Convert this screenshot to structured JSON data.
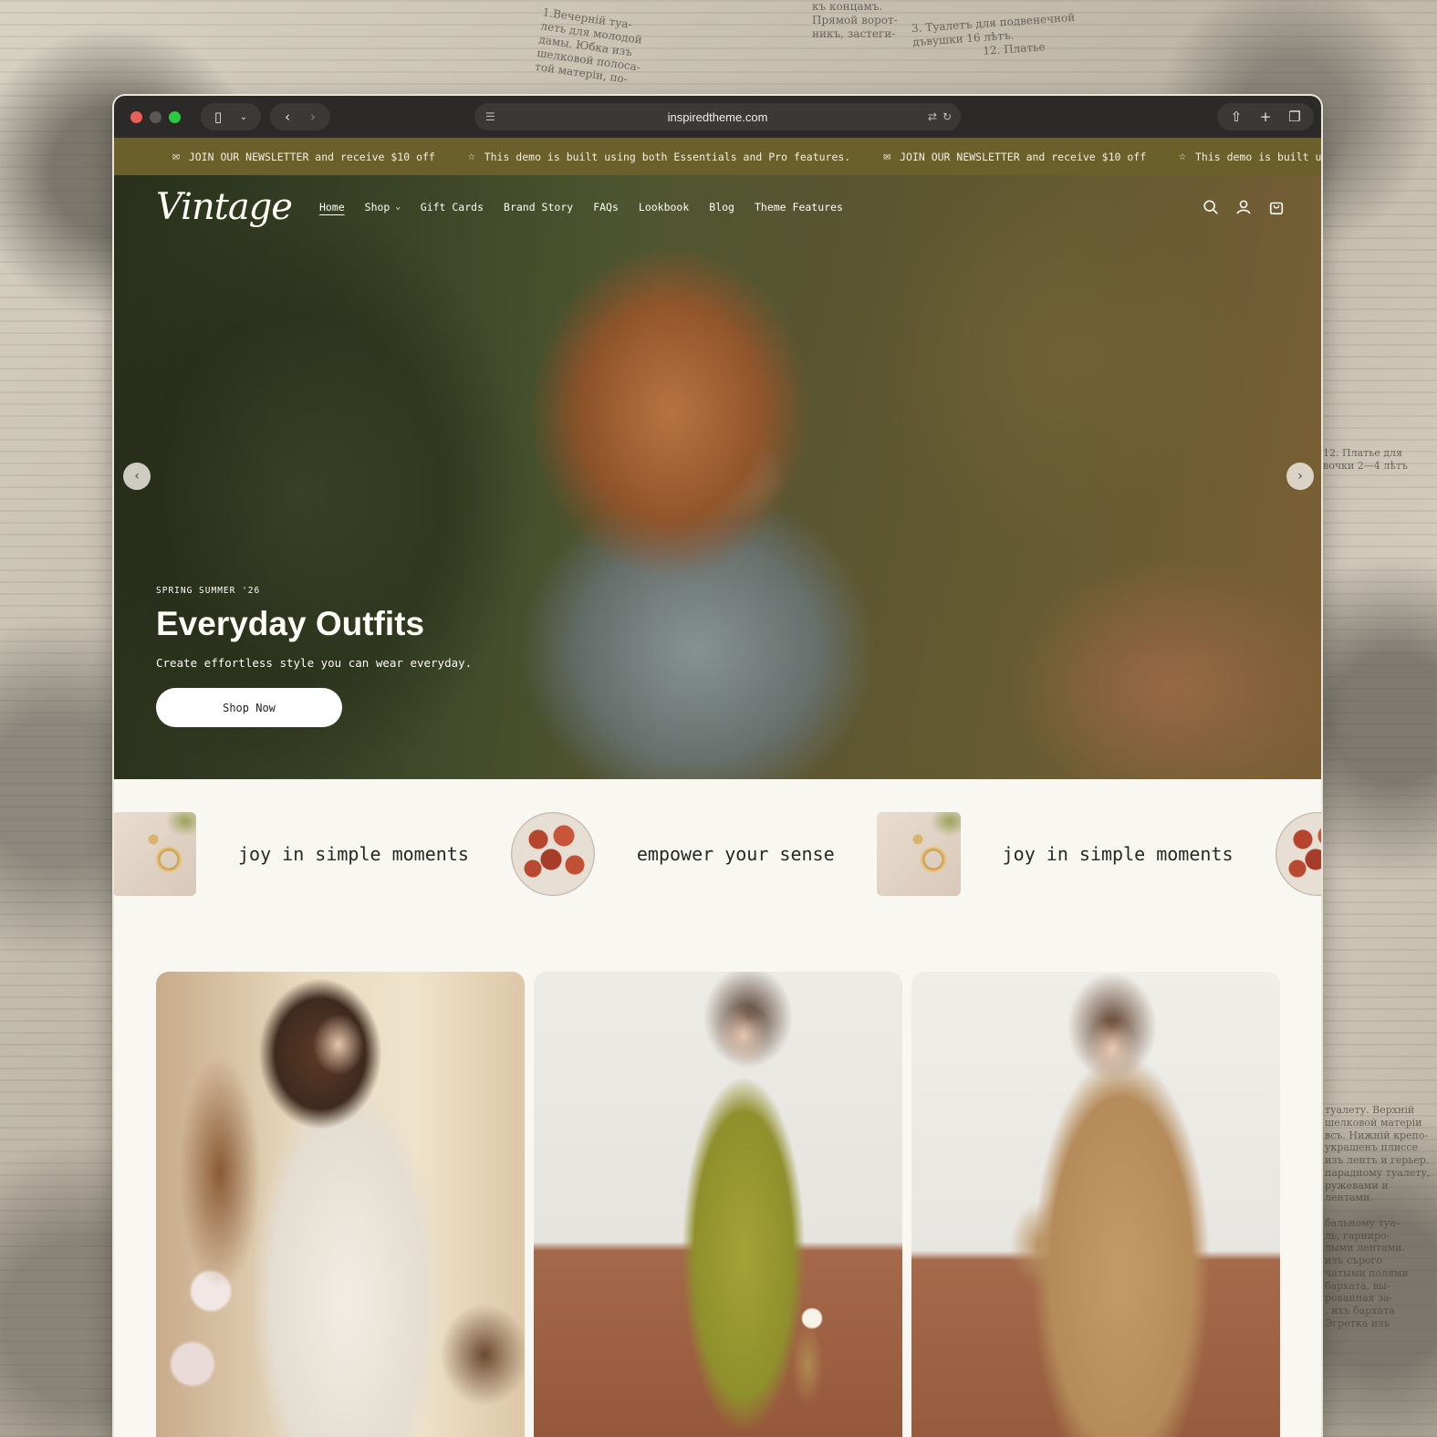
{
  "browser": {
    "url": "inspiredtheme.com",
    "traffic_lights": [
      "#ec5f57",
      "#5a5955",
      "#2bc840"
    ]
  },
  "announcement": {
    "items": [
      {
        "icon": "mail-icon",
        "text": "JOIN OUR NEWSLETTER and receive $10 off"
      },
      {
        "icon": "star-icon",
        "text": "This demo is built using both Essentials and Pro features."
      },
      {
        "icon": "mail-icon",
        "text": "JOIN OUR NEWSLETTER and receive $10 off"
      },
      {
        "icon": "star-icon",
        "text": "This demo is built using both Essentials and Pro features."
      }
    ],
    "bg_color": "#6b5f2c"
  },
  "header": {
    "logo": "Vintage",
    "menu": [
      {
        "label": "Home",
        "active": true
      },
      {
        "label": "Shop",
        "has_dropdown": true
      },
      {
        "label": "Gift Cards"
      },
      {
        "label": "Brand Story"
      },
      {
        "label": "FAQs"
      },
      {
        "label": "Lookbook"
      },
      {
        "label": "Blog"
      },
      {
        "label": "Theme Features"
      }
    ],
    "icons": [
      "search-icon",
      "account-icon",
      "cart-icon"
    ]
  },
  "hero": {
    "eyebrow": "SPRING SUMMER '26",
    "title": "Everyday Outfits",
    "subtitle": "Create effortless style you can wear everyday.",
    "cta": "Shop Now"
  },
  "marquee": {
    "items": [
      {
        "image": "jewelry-image",
        "text": "joy in simple moments"
      },
      {
        "image": "figs-image",
        "text": "empower your sense"
      },
      {
        "image": "jewelry-image",
        "text": "joy in simple moments"
      },
      {
        "image": "figs-image",
        "text": ""
      }
    ]
  },
  "products": [
    {
      "image": "white-dress-image"
    },
    {
      "image": "green-dress-image"
    },
    {
      "image": "tan-dress-image"
    }
  ]
}
